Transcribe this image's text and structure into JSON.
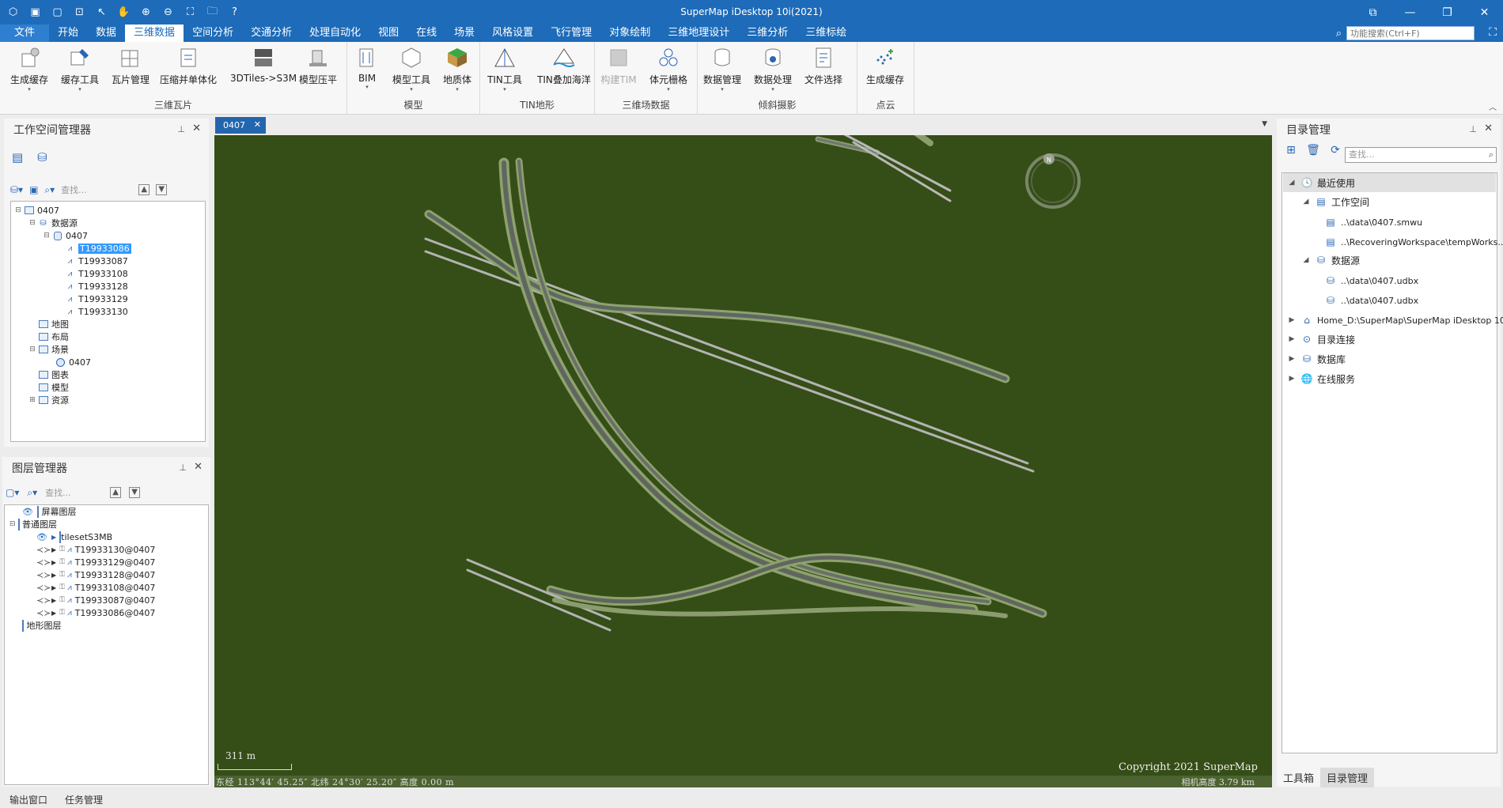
{
  "window": {
    "title": "SuperMap iDesktop 10i(2021)",
    "quick_icons": [
      "app-logo-icon",
      "save-icon",
      "new-icon",
      "save-as-icon",
      "pointer-icon",
      "pan-icon",
      "zoom-in-icon",
      "zoom-out-icon",
      "full-extent-icon",
      "open-folder-icon",
      "help-icon"
    ]
  },
  "menu": {
    "items": [
      "文件",
      "开始",
      "数据",
      "三维数据",
      "空间分析",
      "交通分析",
      "处理自动化",
      "视图",
      "在线",
      "场景",
      "风格设置",
      "飞行管理",
      "对象绘制",
      "三维地理设计",
      "三维分析",
      "三维标绘"
    ],
    "active_index": 3,
    "search_placeholder": "功能搜索(Ctrl+F)"
  },
  "ribbon": {
    "groups": [
      {
        "label": "三维瓦片",
        "buttons": [
          "生成缓存",
          "缓存工具",
          "瓦片管理",
          "压缩并单体化",
          "3DTiles->S3M",
          "模型压平"
        ]
      },
      {
        "label": "模型",
        "buttons": [
          "BIM",
          "模型工具",
          "地质体"
        ]
      },
      {
        "label": "TIN地形",
        "buttons": [
          "TIN工具",
          "TIN叠加海洋"
        ]
      },
      {
        "label": "三维场数据",
        "buttons": [
          "构建TIM",
          "体元栅格"
        ]
      },
      {
        "label": "倾斜摄影",
        "buttons": [
          "数据管理",
          "数据处理",
          "文件选择"
        ]
      },
      {
        "label": "点云",
        "buttons": [
          "生成缓存"
        ]
      }
    ]
  },
  "workspace_manager": {
    "title": "工作空间管理器",
    "search_placeholder": "查找...",
    "tree": {
      "workspace": "0407",
      "datasources_label": "数据源",
      "datasource": "0407",
      "datasets": [
        "T19933086",
        "T19933087",
        "T19933108",
        "T19933128",
        "T19933129",
        "T19933130"
      ],
      "selected_dataset": "T19933086",
      "maps_label": "地图",
      "layouts_label": "布局",
      "scenes_label": "场景",
      "scene": "0407",
      "symbols_label": "图表",
      "models_label": "模型",
      "resources_label": "资源"
    }
  },
  "layer_manager": {
    "title": "图层管理器",
    "search_placeholder": "查找...",
    "screen_layer": "屏幕图层",
    "normal_layer": "普通图层",
    "tileset": "tilesetS3MB",
    "layers": [
      "T19933130@0407",
      "T19933129@0407",
      "T19933128@0407",
      "T19933108@0407",
      "T19933087@0407",
      "T19933086@0407"
    ],
    "terrain_layer": "地形图层"
  },
  "scene": {
    "tab": "0407",
    "scale_text": "311 m",
    "copyright": "Copyright 2021 SuperMap",
    "coords_text": "东经 113°44′ 45.25″ 北纬 24°30′ 25.20″ 高度 0.00 m",
    "camera_text": "相机高度 3.79 km",
    "compass_label": "N",
    "background_color": "#354d16"
  },
  "catalog": {
    "title": "目录管理",
    "search_placeholder": "查找...",
    "recent": "最近使用",
    "workspace": "工作空间",
    "workspace_files": [
      "..\\data\\0407.smwu",
      "..\\RecoveringWorkspace\\tempWorks..."
    ],
    "datasource": "数据源",
    "datasource_files": [
      "..\\data\\0407.udbx",
      "..\\data\\0407.udbx"
    ],
    "home": "Home_D:\\SuperMap\\SuperMap iDesktop 10...",
    "catalog_link": "目录连接",
    "database": "数据库",
    "online": "在线服务",
    "tabs": [
      "工具箱",
      "目录管理"
    ]
  },
  "bottom_tabs": [
    "输出窗口",
    "任务管理"
  ]
}
